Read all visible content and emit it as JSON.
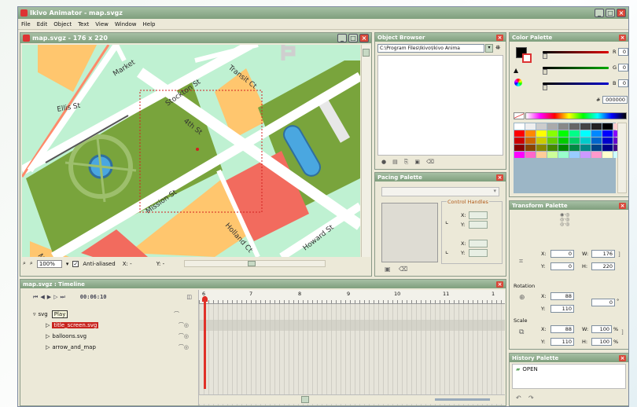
{
  "app": {
    "title": "Ikivo Animator - map.svgz",
    "menu": [
      "File",
      "Edit",
      "Object",
      "Text",
      "View",
      "Window",
      "Help"
    ]
  },
  "doc": {
    "title": "map.svgz - 176 x 220",
    "status": {
      "zoom": "100%",
      "antialiased_label": "Anti-aliased",
      "x_label": "X: -",
      "y_label": "Y: -"
    }
  },
  "map": {
    "streets": [
      "Market",
      "Stockton St",
      "Transit Ct",
      "Ellis St",
      "4th St",
      "Mission St",
      "Holland Ct",
      "Howard St",
      "Mi"
    ],
    "colors": {
      "bg": "#bff1d2",
      "road": "#ffffff",
      "green": "#79a43c",
      "orange": "#ffc66e",
      "red": "#f26b5e",
      "blue": "#4aa7e0",
      "grey": "#e7e7e7"
    }
  },
  "object_browser": {
    "title": "Object Browser",
    "path": "C:\\Program Files\\Ikivo\\Ikivo Anima"
  },
  "pacing": {
    "title": "Pacing Palette",
    "control_handles": "Control Handles",
    "x": "X:",
    "y": "Y:"
  },
  "color_palette": {
    "title": "Color Palette",
    "r_label": "R",
    "g_label": "G",
    "b_label": "B",
    "r": "0",
    "g": "0",
    "b": "0",
    "hex_prefix": "#",
    "hex": "000000"
  },
  "transform": {
    "title": "Transform Palette",
    "x_label": "X:",
    "y_label": "Y:",
    "w_label": "W:",
    "h_label": "H:",
    "x": "0",
    "y": "0",
    "w": "176",
    "h": "220",
    "rotation_label": "Rotation",
    "rot_x": "88",
    "rot_y": "110",
    "rot_deg": "0",
    "scale_label": "Scale",
    "scale_x": "88",
    "scale_y": "110",
    "scale_w": "100",
    "scale_h": "100",
    "pct": "%"
  },
  "history": {
    "title": "History Palette",
    "items": [
      "OPEN"
    ]
  },
  "timeline": {
    "title": "map.svgz : Timeline",
    "time": "00:06:10",
    "root": "svg",
    "tooltip": "Play",
    "layers": [
      "title_screen.svg",
      "balloons.svg",
      "arrow_and_map"
    ],
    "frame_numbers": [
      "6",
      "7",
      "8",
      "9",
      "10",
      "11",
      "1"
    ]
  }
}
